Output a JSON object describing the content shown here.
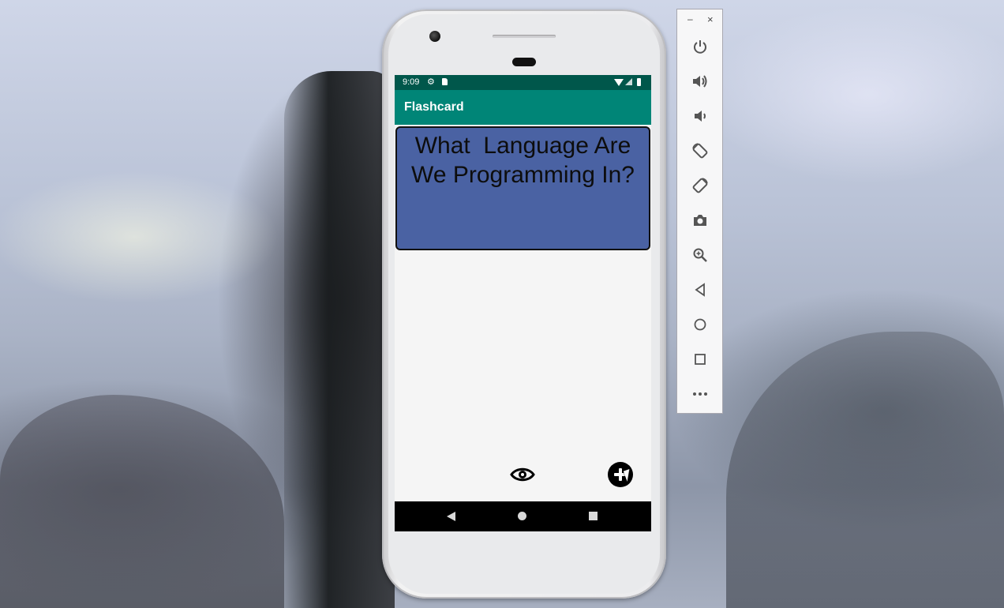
{
  "status_bar": {
    "time": "9:09"
  },
  "app_bar": {
    "title": "Flashcard"
  },
  "card": {
    "question": "What  Language Are We Programming In?"
  },
  "emulator_toolbar": {
    "minimize": "–",
    "close": "×",
    "buttons": [
      "power-icon",
      "volume-up-icon",
      "volume-down-icon",
      "rotate-left-icon",
      "rotate-right-icon",
      "camera-icon",
      "zoom-icon",
      "back-icon",
      "home-icon",
      "overview-icon",
      "more-icon"
    ]
  },
  "colors": {
    "status_bar": "#00574b",
    "app_bar": "#008577",
    "card": "#4a62a3"
  }
}
